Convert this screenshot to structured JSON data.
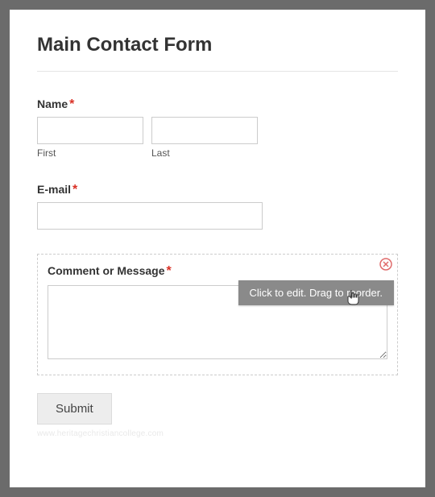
{
  "form": {
    "title": "Main Contact Form",
    "name": {
      "label": "Name",
      "required": "*",
      "first_value": "",
      "last_value": "",
      "first_sub": "First",
      "last_sub": "Last"
    },
    "email": {
      "label": "E-mail",
      "required": "*",
      "value": ""
    },
    "comment": {
      "label": "Comment or Message",
      "required": "*",
      "value": "",
      "tooltip": "Click to edit. Drag to reorder."
    },
    "submit_label": "Submit",
    "watermark": "www.heritagechristiancollege.com"
  }
}
